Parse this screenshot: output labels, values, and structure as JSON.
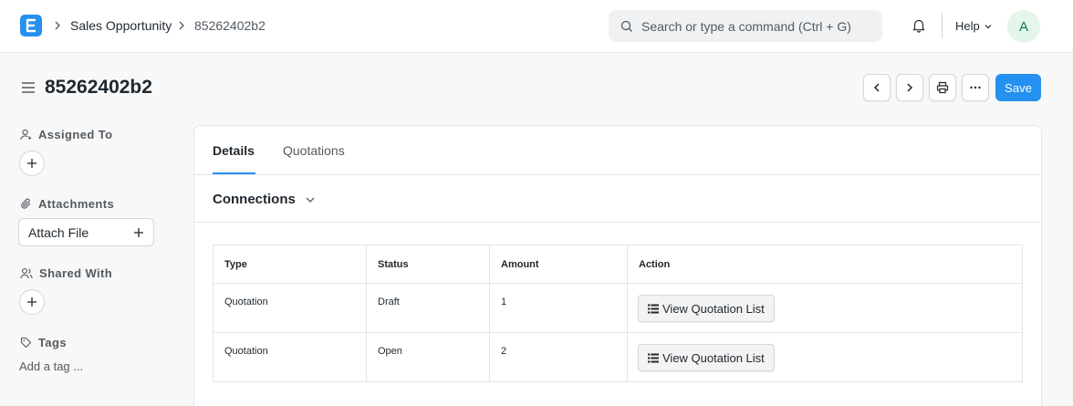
{
  "navbar": {
    "breadcrumbs": [
      "Sales Opportunity",
      "85262402b2"
    ],
    "search_placeholder": "Search or type a command (Ctrl + G)",
    "help_label": "Help",
    "avatar_initial": "A"
  },
  "page": {
    "title": "85262402b2",
    "save_label": "Save"
  },
  "sidebar": {
    "assigned_to_label": "Assigned To",
    "attachments_label": "Attachments",
    "attach_file_label": "Attach File",
    "shared_with_label": "Shared With",
    "tags_label": "Tags",
    "add_tag_label": "Add a tag ..."
  },
  "tabs": [
    "Details",
    "Quotations"
  ],
  "connections": {
    "title": "Connections",
    "columns": [
      "Type",
      "Status",
      "Amount",
      "Action"
    ],
    "rows": [
      {
        "type": "Quotation",
        "status": "Draft",
        "amount": "1",
        "action": "View Quotation List"
      },
      {
        "type": "Quotation",
        "status": "Open",
        "amount": "2",
        "action": "View Quotation List"
      }
    ]
  },
  "colors": {
    "primary": "#2490ef",
    "text": "#1f272e",
    "muted": "#525a61",
    "border": "#d1d8dd",
    "background": "#f8f8f8"
  },
  "icons": [
    "app-logo-icon",
    "chevron-right-icon",
    "search-icon",
    "bell-icon",
    "chevron-down-icon",
    "hamburger-icon",
    "chevron-left-icon",
    "printer-icon",
    "more-icon",
    "user-plus-icon",
    "plus-icon",
    "paperclip-icon",
    "users-icon",
    "tag-icon",
    "list-icon"
  ]
}
